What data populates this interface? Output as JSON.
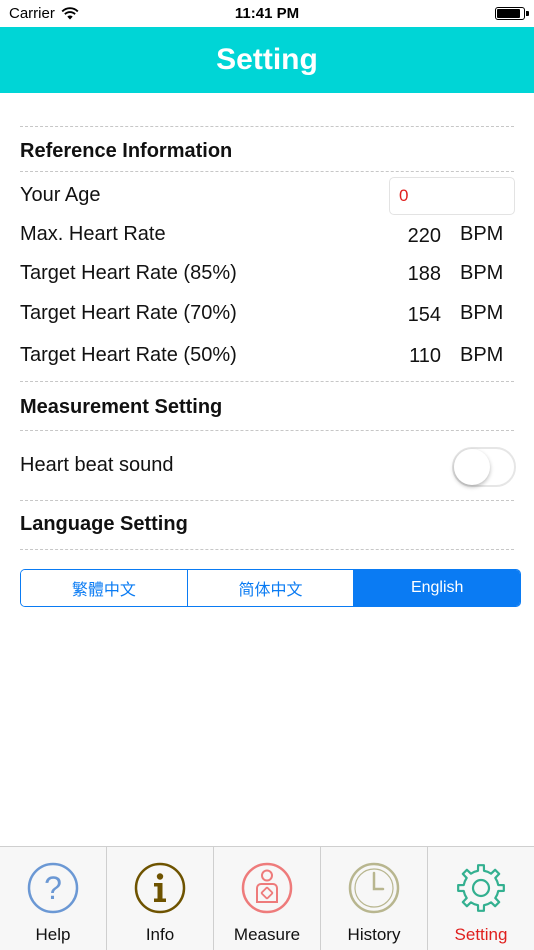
{
  "status_bar": {
    "carrier": "Carrier",
    "time": "11:41 PM",
    "battery_level": 0.92
  },
  "nav": {
    "title": "Setting"
  },
  "reference": {
    "title": "Reference Information",
    "age_label": "Your Age",
    "age_value": "0",
    "rows": [
      {
        "label": "Max. Heart Rate",
        "value": "220",
        "unit": "BPM"
      },
      {
        "label": "Target Heart Rate (85%)",
        "value": "188",
        "unit": "BPM"
      },
      {
        "label": "Target Heart Rate (70%)",
        "value": "154",
        "unit": "BPM"
      },
      {
        "label": "Target Heart Rate (50%)",
        "value": "110",
        "unit": "BPM"
      }
    ]
  },
  "measurement": {
    "title": "Measurement Setting",
    "sound_label": "Heart beat sound",
    "sound_on": false
  },
  "language": {
    "title": "Language Setting",
    "options": [
      "繁體中文",
      "简体中文",
      "English"
    ],
    "selected": "English"
  },
  "tabs": [
    {
      "label": "Help",
      "icon": "question-icon"
    },
    {
      "label": "Info",
      "icon": "info-icon"
    },
    {
      "label": "Measure",
      "icon": "measure-icon"
    },
    {
      "label": "History",
      "icon": "clock-icon"
    },
    {
      "label": "Setting",
      "icon": "gear-icon",
      "active": true
    }
  ],
  "colors": {
    "nav": "#00d5d6",
    "accent": "#0a7bf3",
    "active_tab": "#e0201e",
    "age_value": "#e0201e"
  }
}
